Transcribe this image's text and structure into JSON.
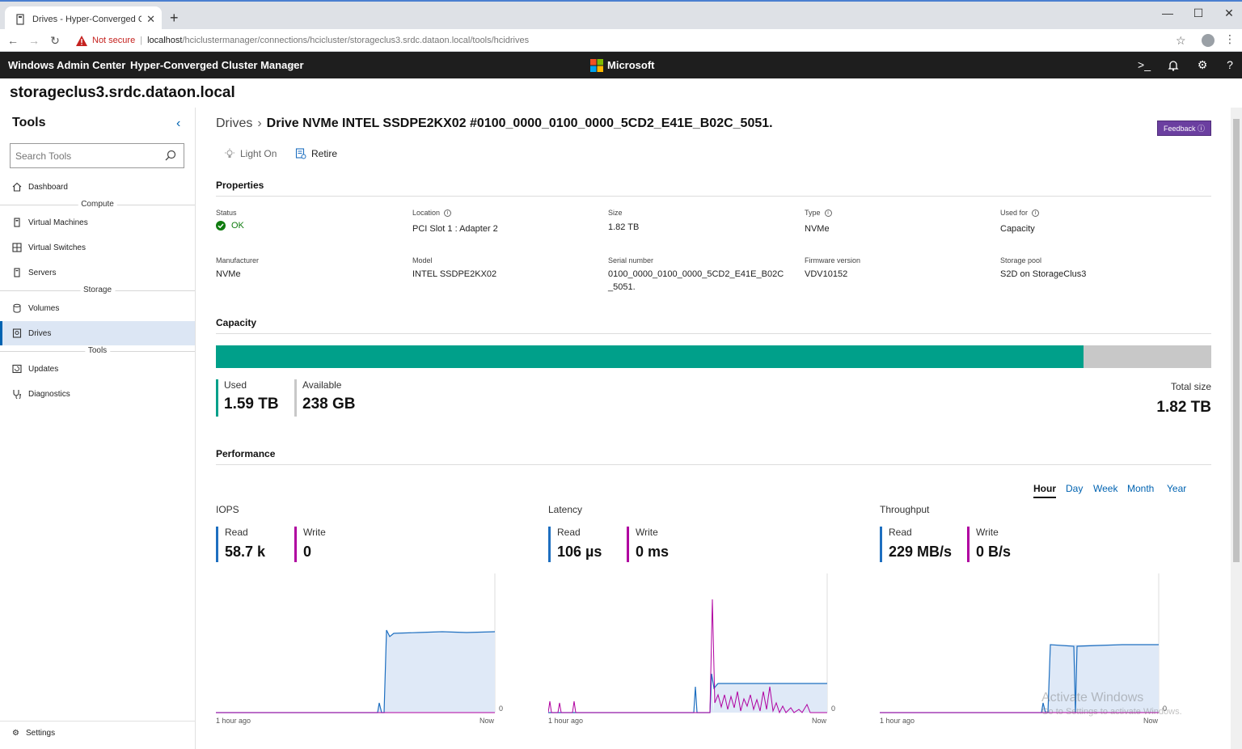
{
  "browser": {
    "tab_title": "Drives - Hyper-Converged Cluste",
    "tab_close": "✕",
    "new_tab": "+",
    "security_label": "Not secure",
    "url_host": "localhost",
    "url_path": "/hciclustermanager/connections/hcicluster/storageclus3.srdc.dataon.local/tools/hcidrives"
  },
  "header": {
    "brand": "Windows Admin Center",
    "tool": "Hyper-Converged Cluster Manager",
    "vendor": "Microsoft"
  },
  "page_title": "storageclus3.srdc.dataon.local",
  "sidebar": {
    "title": "Tools",
    "search_placeholder": "Search Tools",
    "dashboard": "Dashboard",
    "group_compute": "Compute",
    "virtual_machines": "Virtual Machines",
    "virtual_switches": "Virtual Switches",
    "servers": "Servers",
    "group_storage": "Storage",
    "volumes": "Volumes",
    "drives": "Drives",
    "group_tools": "Tools",
    "updates": "Updates",
    "diagnostics": "Diagnostics",
    "settings": "Settings"
  },
  "breadcrumb": {
    "parent": "Drives",
    "current": "Drive NVMe INTEL SSDPE2KX02 #0100_0000_0100_0000_5CD2_E41E_B02C_5051."
  },
  "feedback_label": "Feedback ⓘ",
  "actions": {
    "light_on": "Light On",
    "retire": "Retire"
  },
  "properties": {
    "section_title": "Properties",
    "status_label": "Status",
    "status_value": "OK",
    "location_label": "Location",
    "location_value": "PCI Slot 1 : Adapter 2",
    "size_label": "Size",
    "size_value": "1.82 TB",
    "type_label": "Type",
    "type_value": "NVMe",
    "used_for_label": "Used for",
    "used_for_value": "Capacity",
    "manufacturer_label": "Manufacturer",
    "manufacturer_value": "NVMe",
    "model_label": "Model",
    "model_value": "INTEL SSDPE2KX02",
    "serial_label": "Serial number",
    "serial_value": "0100_0000_0100_0000_5CD2_E41E_B02C_5051.",
    "firmware_label": "Firmware version",
    "firmware_value": "VDV10152",
    "pool_label": "Storage pool",
    "pool_value": "S2D on StorageClus3",
    "info_glyph": "i"
  },
  "capacity": {
    "section_title": "Capacity",
    "used_label": "Used",
    "used_value": "1.59 TB",
    "available_label": "Available",
    "available_value": "238 GB",
    "total_label": "Total size",
    "total_value": "1.82 TB",
    "used_fraction": 0.872,
    "colors": {
      "used": "#00a08a",
      "available": "#c8c8c8"
    }
  },
  "performance": {
    "section_title": "Performance",
    "ranges": [
      "Hour",
      "Day",
      "Week",
      "Month",
      "Year"
    ],
    "active_range": "Hour",
    "charts": [
      {
        "title": "IOPS",
        "read_label": "Read",
        "read_value": "58.7 k",
        "write_label": "Write",
        "write_value": "0",
        "x_start": "1 hour ago",
        "x_end": "Now",
        "y_zero": "0"
      },
      {
        "title": "Latency",
        "read_label": "Read",
        "read_value": "106 µs",
        "write_label": "Write",
        "write_value": "0 ms",
        "x_start": "1 hour ago",
        "x_end": "Now",
        "y_zero": "0"
      },
      {
        "title": "Throughput",
        "read_label": "Read",
        "read_value": "229 MB/s",
        "write_label": "Write",
        "write_value": "0 B/s",
        "x_start": "1 hour ago",
        "x_end": "Now",
        "y_zero": "0"
      }
    ],
    "colors": {
      "read": "#1e6fc0",
      "write": "#b000a0"
    }
  },
  "watermark": {
    "line1": "Activate Windows",
    "line2": "Go to Settings to activate Windows."
  }
}
